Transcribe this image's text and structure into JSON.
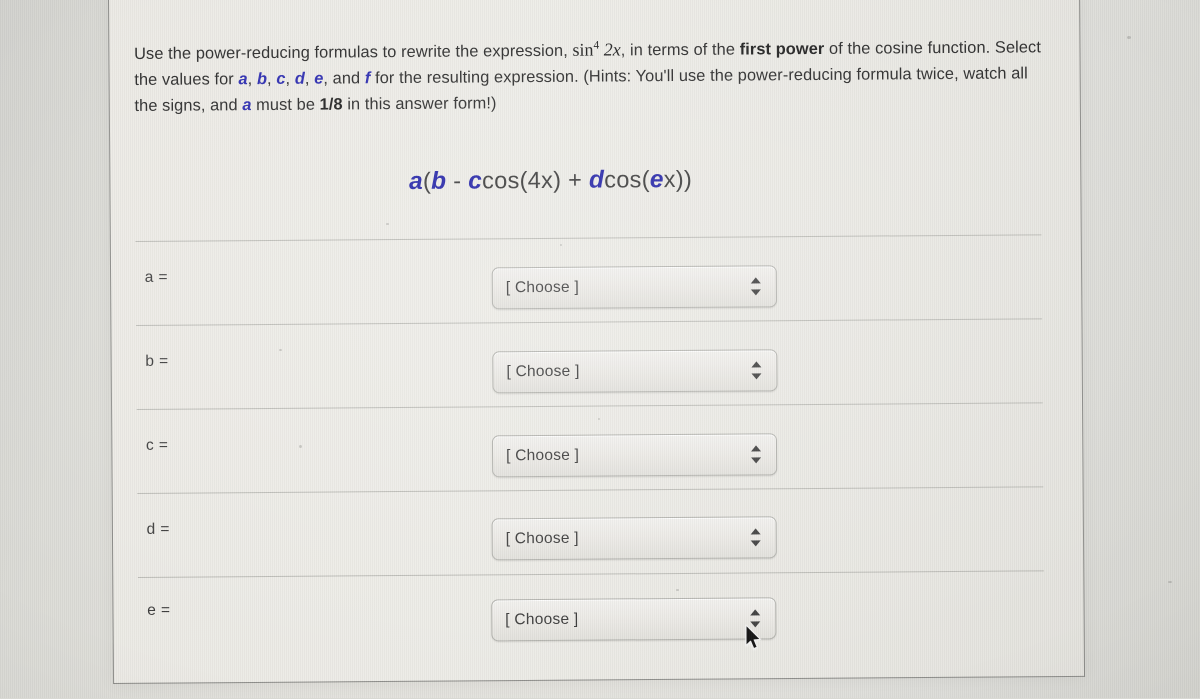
{
  "question": {
    "line1_pre": "Use the power-reducing formulas to rewrite the expression, ",
    "math_sin": "sin",
    "math_exp": "4",
    "math_arg": "2x",
    "line1_mid": ", in terms of the ",
    "line1_bold": "first power",
    "line2_pre": "of the cosine function. Select the values for ",
    "vars_inline": [
      "a",
      "b",
      "c",
      "d",
      "e",
      "f"
    ],
    "line2_and": ", and ",
    "line2_post": " for the resulting expression.",
    "line3_pre": "(Hints: You'll use the power-reducing formula twice, watch all the signs, and ",
    "line3_var": "a",
    "line3_mid": " must be ",
    "line3_bold": "1/8",
    "line3_post": " in",
    "line4": "this answer form!)"
  },
  "expression": {
    "a": "a",
    "open1": "(",
    "b": "b",
    "minus": " - ",
    "c": "c",
    "cos1": "cos(4x)",
    "plus": " + ",
    "d": "d",
    "cos2_open": "cos(",
    "e": "e",
    "cos2_close": "x))"
  },
  "rows": [
    {
      "label": "a =",
      "value": "[ Choose ]"
    },
    {
      "label": "b =",
      "value": "[ Choose ]"
    },
    {
      "label": "c =",
      "value": "[ Choose ]"
    },
    {
      "label": "d =",
      "value": "[ Choose ]"
    },
    {
      "label": "e =",
      "value": "[ Choose ]"
    }
  ],
  "colors": {
    "variable_blue": "#2222a8",
    "text_dark": "#2b2b2b",
    "page_background": "#e9e8e3",
    "separator": "#b9b9b4",
    "select_border": "#b3b3ae"
  }
}
